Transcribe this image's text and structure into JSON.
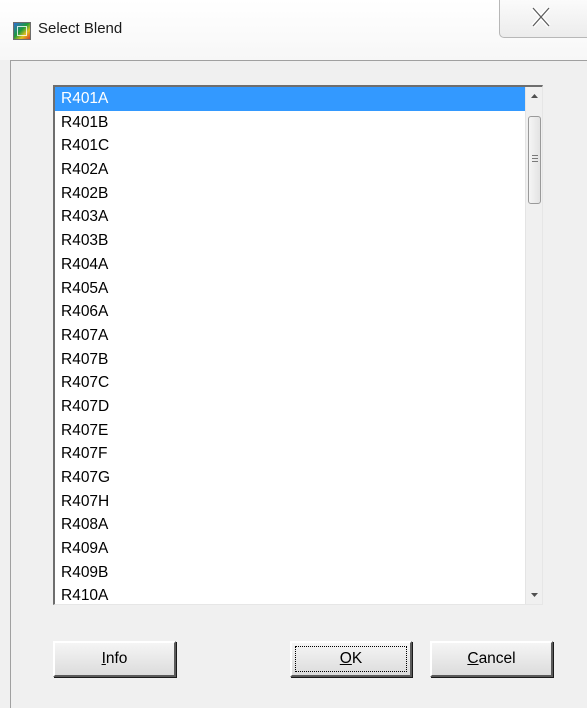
{
  "window": {
    "title": "Select Blend",
    "app_icon": "nist-refprop-icon",
    "close_icon": "close-icon"
  },
  "listbox": {
    "selected_index": 0,
    "items": [
      "R401A",
      "R401B",
      "R401C",
      "R402A",
      "R402B",
      "R403A",
      "R403B",
      "R404A",
      "R405A",
      "R406A",
      "R407A",
      "R407B",
      "R407C",
      "R407D",
      "R407E",
      "R407F",
      "R407G",
      "R407H",
      "R408A",
      "R409A",
      "R409B",
      "R410A"
    ],
    "scroll_up_icon": "arrow-up-icon",
    "scroll_down_icon": "arrow-down-icon",
    "scroll_fraction": 0
  },
  "buttons": {
    "info": {
      "hotkey": "I",
      "rest": "nfo"
    },
    "ok": {
      "hotkey": "O",
      "rest": "K"
    },
    "cancel": {
      "hotkey": "C",
      "rest": "ancel"
    }
  },
  "colors": {
    "selection": "#3399ff",
    "selection_text": "#ffffff",
    "dialog_face": "#f0f0f0"
  }
}
